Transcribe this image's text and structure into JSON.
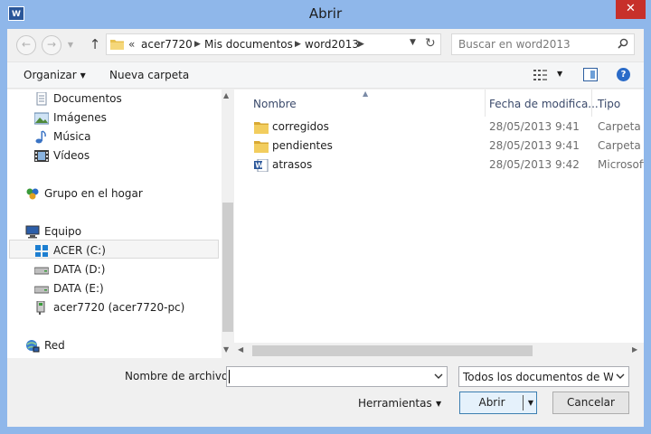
{
  "window": {
    "title": "Abrir",
    "app_icon_letter": "W",
    "close_glyph": "✕"
  },
  "nav_buttons": {
    "back": "←",
    "forward": "→",
    "up": "↑"
  },
  "address": {
    "overflow": "«",
    "segments": [
      "acer7720",
      "Mis documentos",
      "word2013"
    ]
  },
  "search": {
    "placeholder": "Buscar en word2013"
  },
  "toolbar": {
    "organize": "Organizar",
    "new_folder": "Nueva carpeta",
    "help": "?"
  },
  "nav_pane": {
    "items": [
      {
        "label": "Documentos",
        "icon": "documents-icon"
      },
      {
        "label": "Imágenes",
        "icon": "pictures-icon"
      },
      {
        "label": "Música",
        "icon": "music-icon"
      },
      {
        "label": "Vídeos",
        "icon": "videos-icon"
      },
      {
        "label": "Grupo en el hogar",
        "icon": "homegroup-icon"
      },
      {
        "label": "Equipo",
        "icon": "computer-icon"
      },
      {
        "label": "ACER (C:)",
        "icon": "system-drive-icon"
      },
      {
        "label": "DATA (D:)",
        "icon": "drive-icon"
      },
      {
        "label": "DATA (E:)",
        "icon": "drive-icon"
      },
      {
        "label": "acer7720 (acer7720-pc)",
        "icon": "network-drive-icon"
      },
      {
        "label": "Red",
        "icon": "network-icon"
      }
    ]
  },
  "file_list": {
    "columns": {
      "name": "Nombre",
      "date": "Fecha de modifica...",
      "type": "Tipo"
    },
    "rows": [
      {
        "name": "corregidos",
        "date": "28/05/2013 9:41",
        "type": "Carpeta de",
        "icon": "folder-icon"
      },
      {
        "name": "pendientes",
        "date": "28/05/2013 9:41",
        "type": "Carpeta de",
        "icon": "folder-icon"
      },
      {
        "name": "atrasos",
        "date": "28/05/2013 9:42",
        "type": "Microsoft",
        "icon": "word-doc-icon"
      }
    ]
  },
  "bottom": {
    "filename_label": "Nombre de archivo:",
    "filename_value": "",
    "filter": "Todos los documentos de Word",
    "tools": "Herramientas",
    "open": "Abrir",
    "cancel": "Cancelar"
  },
  "colors": {
    "titlebar": "#8fb7ea",
    "close": "#c7302a",
    "folder": "#e8c150",
    "accent": "#2a6bc8"
  }
}
